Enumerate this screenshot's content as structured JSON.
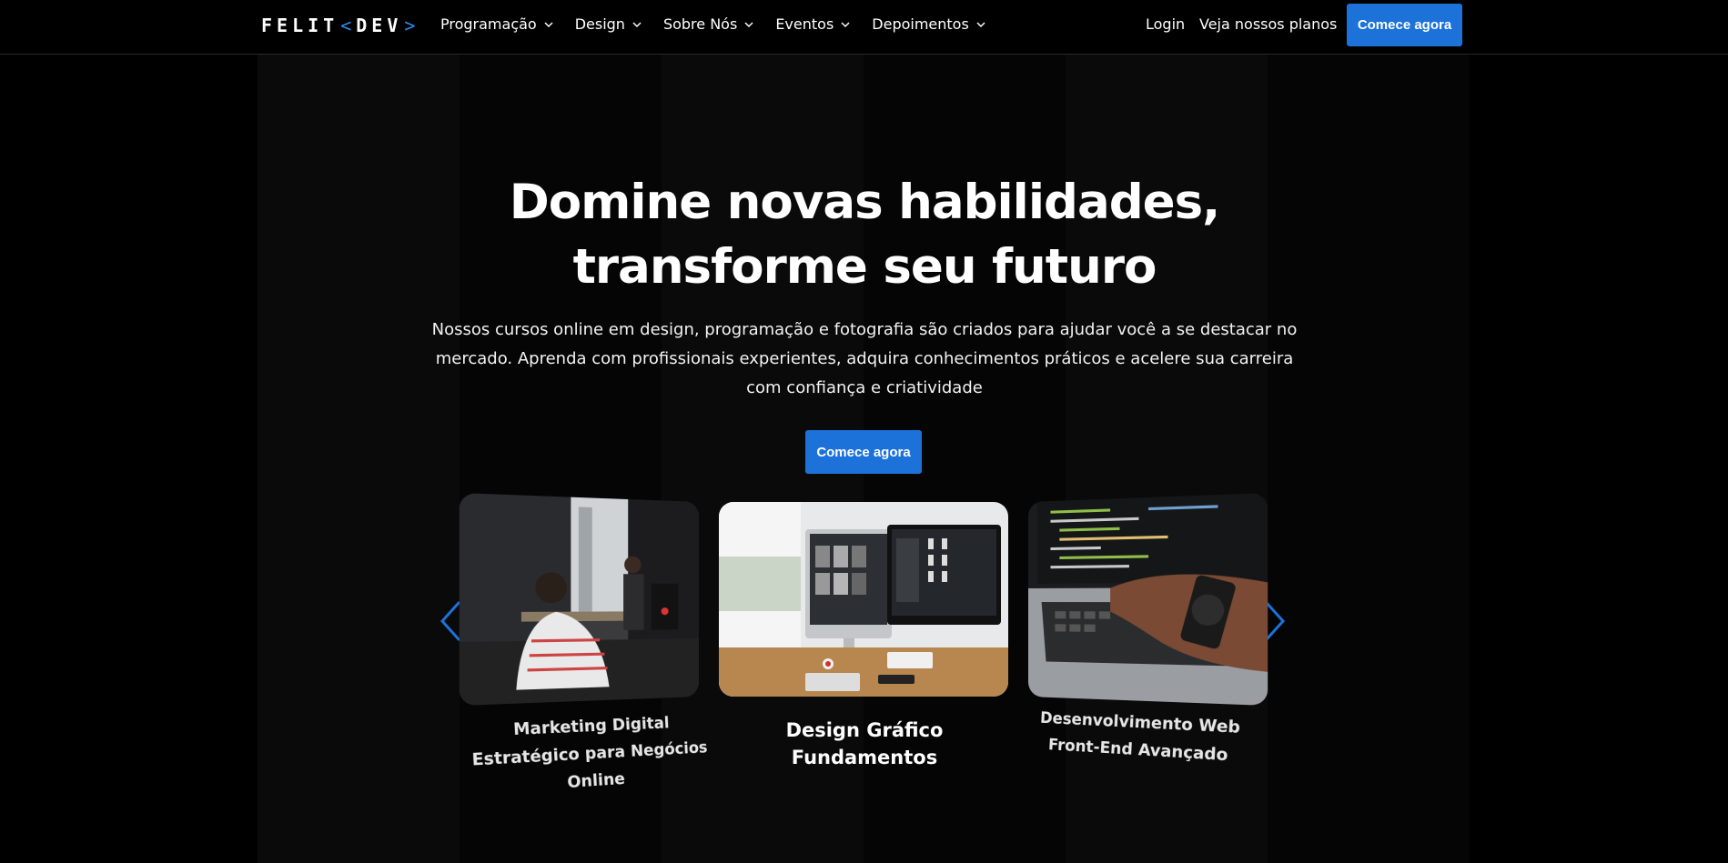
{
  "header": {
    "logo": {
      "left": "FELIT",
      "open": "<",
      "right": "DEV",
      "close": ">"
    },
    "nav": [
      {
        "label": "Programação"
      },
      {
        "label": "Design"
      },
      {
        "label": "Sobre Nós"
      },
      {
        "label": "Eventos"
      },
      {
        "label": "Depoimentos"
      }
    ],
    "login": "Login",
    "plans": "Veja nossos planos",
    "cta": "Comece agora"
  },
  "hero": {
    "title_line1": "Domine novas habilidades,",
    "title_line2": "transforme seu futuro",
    "subtitle": "Nossos cursos online em design, programação e fotografia são criados para ajudar você a se destacar no mercado. Aprenda com profissionais experientes, adquira conhecimentos práticos e acelere sua carreira com confiança e criatividade",
    "cta": "Comece agora"
  },
  "carousel": {
    "prev_icon": "chevron-left-icon",
    "next_icon": "chevron-right-icon",
    "accent": "#1c72d9",
    "cards": [
      {
        "title": "Marketing Digital Estratégico para Negócios Online"
      },
      {
        "title": "Design Gráfico Fundamentos"
      },
      {
        "title": "Desenvolvimento Web Front-End Avançado"
      }
    ]
  }
}
